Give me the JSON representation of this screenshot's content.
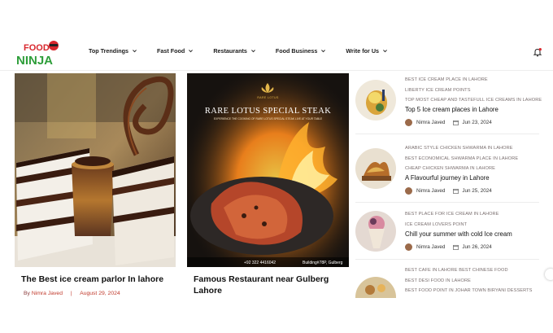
{
  "header": {
    "logo_text_top": "FOOD",
    "logo_text_bottom": "NINJA",
    "nav": [
      {
        "label": "Top Trendings"
      },
      {
        "label": "Fast Food"
      },
      {
        "label": "Restaurants"
      },
      {
        "label": "Food Business"
      },
      {
        "label": "Write for Us"
      }
    ]
  },
  "cards": [
    {
      "title": "The Best ice cream parlor In lahore",
      "by": "By",
      "author": "Nimra Javed",
      "sep": "|",
      "date": "August 29, 2024"
    },
    {
      "title": "Famous Restaurant near Gulberg Lahore",
      "image_heading": "RARE LOTUS SPECIAL STEAK",
      "image_sub": "EXPERIENCE THE COOKING OF RARE LOTUS SPECIAL STEAK LIVE AT YOUR TABLE",
      "brand": "RARE LOTUS",
      "phone": "+92 322 4416042",
      "address": "Building#78P, Gulberg"
    }
  ],
  "sidebar": [
    {
      "tags": [
        "BEST ICE CREAM PLACE IN LAHORE",
        "LIBERTY ICE CREAM POINTS",
        "TOP MOST CHEAP AND TASTEFULL ICE CREAMS IN LAHORE"
      ],
      "title": "Top 5 Ice cream places in Lahore",
      "author": "Nimra Javed",
      "date": "Jun 23, 2024"
    },
    {
      "tags": [
        "ARABIC STYLE CHICKEN SHWARMA IN LAHORE",
        "BEST ECONOMICAL SHWARMA PLACE IN LAHORE",
        "CHEAP CHICKEN SHWARMA IN LAHORE"
      ],
      "title": "A Flavourful journey in Lahore",
      "author": "Nimra Javed",
      "date": "Jun 25, 2024"
    },
    {
      "tags": [
        "BEST PLACE FOR ICE CREAM IN LAHORE",
        "ICE CREAM LOVERS POINT"
      ],
      "title": "Chill your summer with cold Ice cream",
      "author": "Nimra Javed",
      "date": "Jun 26, 2024"
    },
    {
      "tags": [
        "BEST CAFE IN LAHORE BEST CHINESE FOOD",
        "BEST DESI FOOD IN LAHORE",
        "BEST FOOD POINT IN JOHAR TOWN BIRYANI DESSERTS"
      ]
    }
  ],
  "colors": {
    "brand_red": "#d8262c",
    "brand_green": "#2e9e3a",
    "meta_red": "#c0392b"
  }
}
